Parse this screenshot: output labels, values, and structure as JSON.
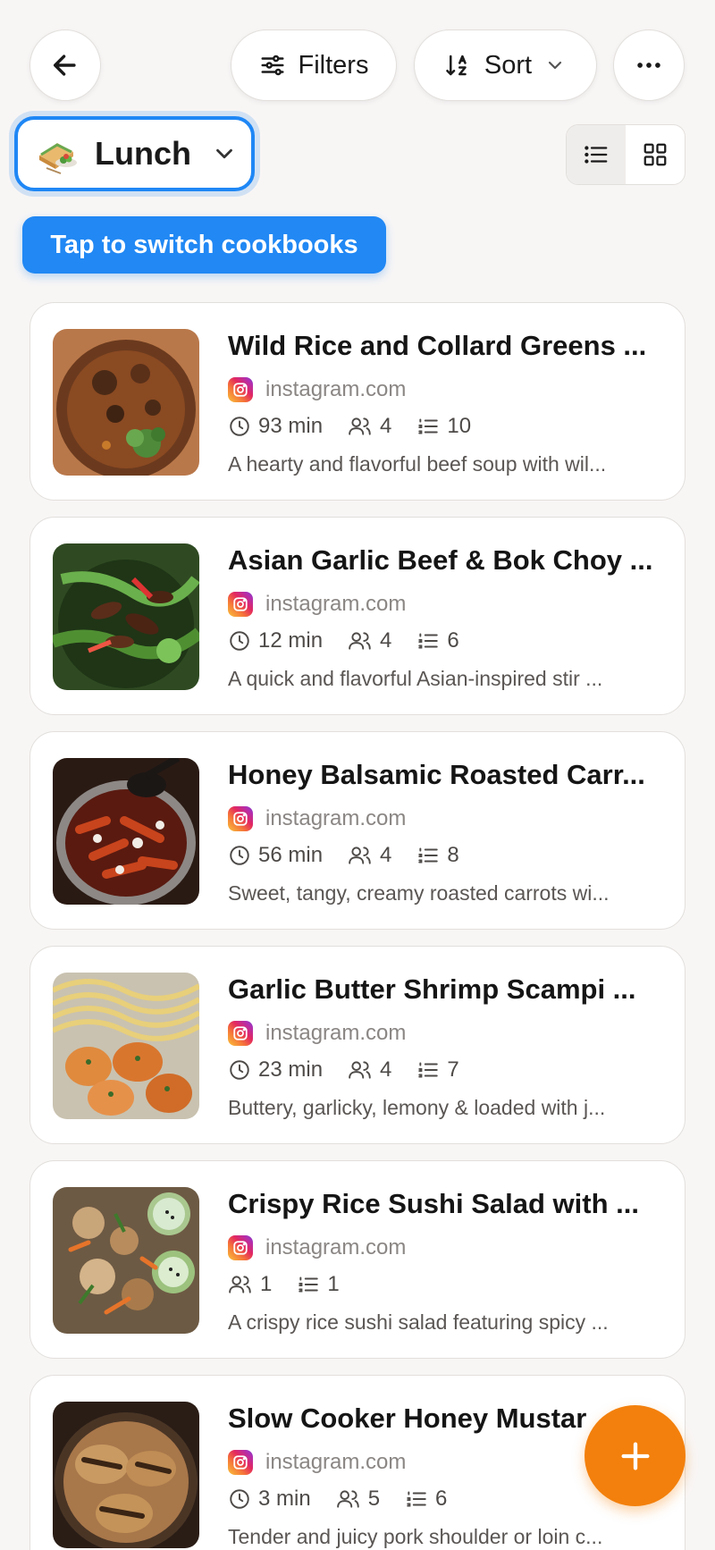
{
  "topbar": {
    "back_icon": "arrow-left-icon",
    "filters_label": "Filters",
    "sort_label": "Sort",
    "more_icon": "ellipsis-icon"
  },
  "cookbook": {
    "name": "Lunch",
    "emoji": "sandwich-salad-icon"
  },
  "view_toggle": {
    "active": "list"
  },
  "tooltip": "Tap to switch cookbooks",
  "recipes": [
    {
      "title": "Wild Rice and Collard Greens ...",
      "source": "instagram.com",
      "time": "93 min",
      "servings": "4",
      "ingredients": "10",
      "description": "A hearty and flavorful beef soup with wil..."
    },
    {
      "title": "Asian Garlic Beef & Bok Choy ...",
      "source": "instagram.com",
      "time": "12 min",
      "servings": "4",
      "ingredients": "6",
      "description": "A quick and flavorful Asian-inspired stir ..."
    },
    {
      "title": "Honey Balsamic Roasted Carr...",
      "source": "instagram.com",
      "time": "56 min",
      "servings": "4",
      "ingredients": "8",
      "description": "Sweet, tangy, creamy roasted carrots wi..."
    },
    {
      "title": "Garlic Butter Shrimp Scampi ...",
      "source": "instagram.com",
      "time": "23 min",
      "servings": "4",
      "ingredients": "7",
      "description": "Buttery, garlicky, lemony & loaded with j..."
    },
    {
      "title": "Crispy Rice Sushi Salad with ...",
      "source": "instagram.com",
      "time": "",
      "servings": "1",
      "ingredients": "1",
      "description": "A crispy rice sushi salad featuring spicy ..."
    },
    {
      "title": "Slow Cooker Honey Mustar",
      "source": "instagram.com",
      "time": "3 min",
      "servings": "5",
      "ingredients": "6",
      "description": "Tender and juicy pork shoulder or loin c..."
    }
  ],
  "colors": {
    "accent": "#1f87f5",
    "fab": "#f3800c",
    "background": "#f8f6f5"
  }
}
